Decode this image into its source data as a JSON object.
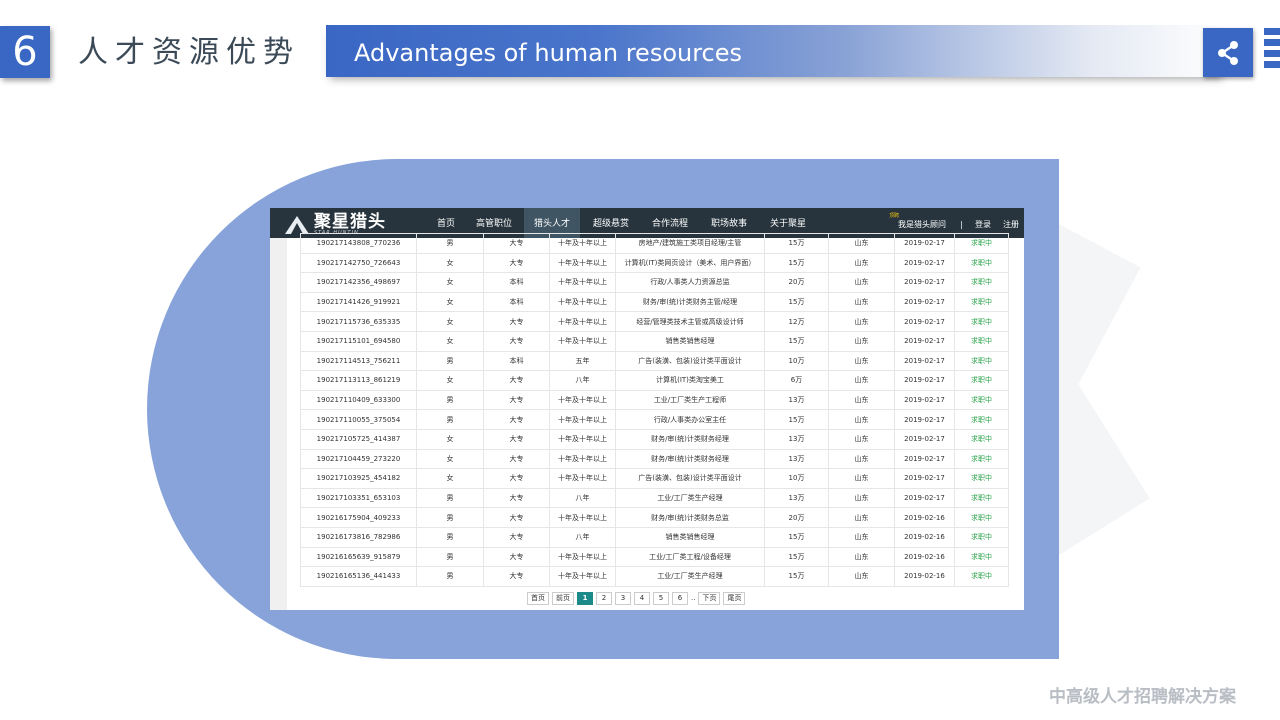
{
  "slide": {
    "number": "6",
    "title_cn": "人才资源优势",
    "title_en": "Advantages of human resources",
    "footer": "中高级人才招聘解决方案",
    "accent_color": "#3a67c4",
    "panel_color": "#87a3da"
  },
  "share_icon": "share-icon",
  "site": {
    "logo": {
      "name": "聚星猎头",
      "sub": "STAR HUNTIN"
    },
    "nav": [
      {
        "label": "首页",
        "active": false
      },
      {
        "label": "高管职位",
        "active": false
      },
      {
        "label": "猎头人才",
        "active": true
      },
      {
        "label": "超级悬赏",
        "active": false
      },
      {
        "label": "合作流程",
        "active": false
      },
      {
        "label": "职场故事",
        "active": false
      },
      {
        "label": "关于聚星",
        "active": false
      }
    ],
    "nav_badge": "顶聘",
    "right": {
      "consultant": "我是猎头顾问",
      "sep": "|",
      "login": "登录",
      "register": "注册"
    }
  },
  "table": {
    "rows": [
      [
        "190217143808_770236",
        "男",
        "大专",
        "十年及十年以上",
        "房地产/建筑施工类项目经理/主管",
        "15万",
        "山东",
        "2019-02-17",
        "求职中"
      ],
      [
        "190217142750_726643",
        "女",
        "大专",
        "十年及十年以上",
        "计算机(IT)类网页设计（美术、用户界面）",
        "15万",
        "山东",
        "2019-02-17",
        "求职中"
      ],
      [
        "190217142356_498697",
        "女",
        "本科",
        "十年及十年以上",
        "行政/人事类人力资源总监",
        "20万",
        "山东",
        "2019-02-17",
        "求职中"
      ],
      [
        "190217141426_919921",
        "女",
        "本科",
        "十年及十年以上",
        "财务/审(统)计类财务主管/经理",
        "15万",
        "山东",
        "2019-02-17",
        "求职中"
      ],
      [
        "190217115736_635335",
        "女",
        "大专",
        "十年及十年以上",
        "经营/管理类技术主管或高级设计师",
        "12万",
        "山东",
        "2019-02-17",
        "求职中"
      ],
      [
        "190217115101_694580",
        "女",
        "大专",
        "十年及十年以上",
        "销售类销售经理",
        "15万",
        "山东",
        "2019-02-17",
        "求职中"
      ],
      [
        "190217114513_756211",
        "男",
        "本科",
        "五年",
        "广告(装潢、包装)设计类平面设计",
        "10万",
        "山东",
        "2019-02-17",
        "求职中"
      ],
      [
        "190217113113_861219",
        "女",
        "大专",
        "八年",
        "计算机(IT)类淘宝美工",
        "6万",
        "山东",
        "2019-02-17",
        "求职中"
      ],
      [
        "190217110409_633300",
        "男",
        "大专",
        "十年及十年以上",
        "工业/工厂类生产工程师",
        "13万",
        "山东",
        "2019-02-17",
        "求职中"
      ],
      [
        "190217110055_375054",
        "男",
        "大专",
        "十年及十年以上",
        "行政/人事类办公室主任",
        "15万",
        "山东",
        "2019-02-17",
        "求职中"
      ],
      [
        "190217105725_414387",
        "女",
        "大专",
        "十年及十年以上",
        "财务/审(统)计类财务经理",
        "13万",
        "山东",
        "2019-02-17",
        "求职中"
      ],
      [
        "190217104459_273220",
        "女",
        "大专",
        "十年及十年以上",
        "财务/审(统)计类财务经理",
        "13万",
        "山东",
        "2019-02-17",
        "求职中"
      ],
      [
        "190217103925_454182",
        "女",
        "大专",
        "十年及十年以上",
        "广告(装潢、包装)设计类平面设计",
        "10万",
        "山东",
        "2019-02-17",
        "求职中"
      ],
      [
        "190217103351_653103",
        "男",
        "大专",
        "八年",
        "工业/工厂类生产经理",
        "13万",
        "山东",
        "2019-02-17",
        "求职中"
      ],
      [
        "190216175904_409233",
        "男",
        "大专",
        "十年及十年以上",
        "财务/审(统)计类财务总监",
        "20万",
        "山东",
        "2019-02-16",
        "求职中"
      ],
      [
        "190216173816_782986",
        "男",
        "大专",
        "八年",
        "销售类销售经理",
        "15万",
        "山东",
        "2019-02-16",
        "求职中"
      ],
      [
        "190216165639_915879",
        "男",
        "大专",
        "十年及十年以上",
        "工业/工厂类工程/设备经理",
        "15万",
        "山东",
        "2019-02-16",
        "求职中"
      ],
      [
        "190216165136_441433",
        "男",
        "大专",
        "十年及十年以上",
        "工业/工厂类生产经理",
        "15万",
        "山东",
        "2019-02-16",
        "求职中"
      ]
    ],
    "status_color": "#2aa34a"
  },
  "pager": {
    "first": "首页",
    "prev": "前页",
    "pages": [
      "1",
      "2",
      "3",
      "4",
      "5",
      "6"
    ],
    "current": "1",
    "ellipsis": "..",
    "next": "下页",
    "last": "尾页"
  }
}
